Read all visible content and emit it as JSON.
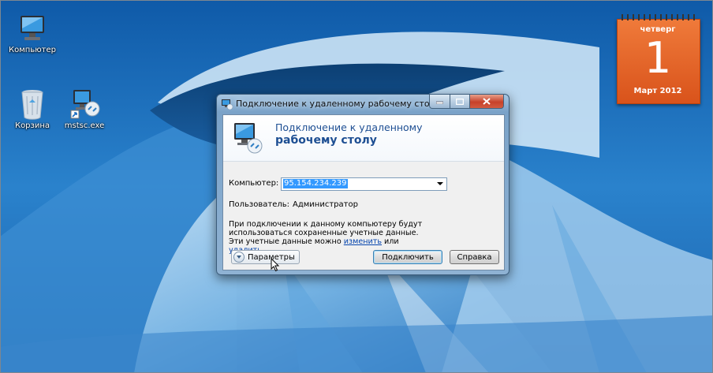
{
  "desktop": {
    "icons": [
      {
        "label": "Компьютер",
        "icon": "computer-icon"
      },
      {
        "label": "Корзина",
        "icon": "recycle-bin-icon"
      },
      {
        "label": "mstsc.exe",
        "icon": "remote-desktop-shortcut-icon"
      }
    ]
  },
  "calendar_gadget": {
    "weekday": "четверг",
    "day": "1",
    "month_year": "Март 2012",
    "color": "#e2642a"
  },
  "rdp_window": {
    "title": "Подключение к удаленному рабочему столу",
    "banner_line1": "Подключение к удаленному",
    "banner_line2": "рабочему столу",
    "computer_label": "Компьютер:",
    "computer_value": "95.154.234.239",
    "user_label": "Пользователь:",
    "user_value": "Администратор",
    "info_text": "При подключении к данному компьютеру будут использоваться сохраненные учетные данные. Эти учетные данные можно",
    "edit_link": "изменить",
    "or_text": "или",
    "delete_link": "удалить",
    "options_label": "Параметры",
    "connect_label": "Подключить",
    "help_label": "Справка"
  },
  "colors": {
    "accent_link": "#0645ad",
    "selection": "#3399ff",
    "banner_text": "#1e4f93",
    "close_button": "#c7412a"
  }
}
